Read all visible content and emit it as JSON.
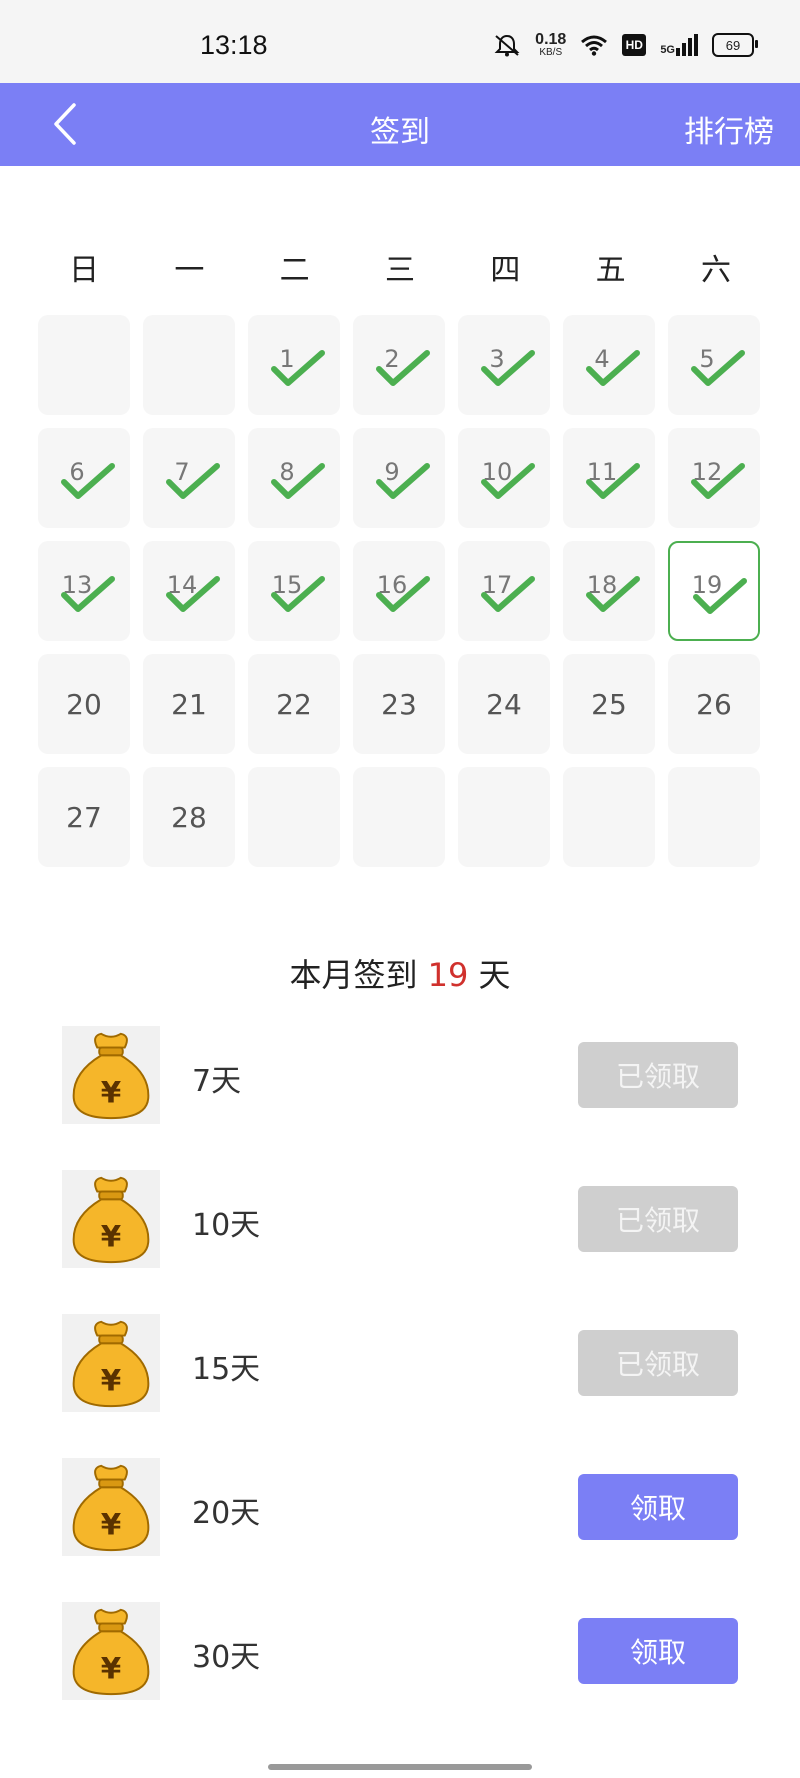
{
  "status_bar": {
    "time": "13:18",
    "speed_value": "0.18",
    "speed_unit": "KB/S",
    "hd": "HD",
    "network": "5G",
    "battery": "69"
  },
  "header": {
    "title": "签到",
    "right_action": "排行榜"
  },
  "calendar": {
    "weekdays": [
      "日",
      "一",
      "二",
      "三",
      "四",
      "五",
      "六"
    ],
    "today": 19,
    "cells": [
      "",
      "",
      "1",
      "2",
      "3",
      "4",
      "5",
      "6",
      "7",
      "8",
      "9",
      "10",
      "11",
      "12",
      "13",
      "14",
      "15",
      "16",
      "17",
      "18",
      "19",
      "20",
      "21",
      "22",
      "23",
      "24",
      "25",
      "26",
      "27",
      "28",
      "",
      "",
      "",
      "",
      ""
    ],
    "checked_up_to": 19
  },
  "summary": {
    "prefix": "本月签到",
    "days": "19",
    "suffix": "天"
  },
  "rewards": [
    {
      "label": "7天",
      "button": "已领取",
      "state": "claimed"
    },
    {
      "label": "10天",
      "button": "已领取",
      "state": "claimed"
    },
    {
      "label": "15天",
      "button": "已领取",
      "state": "claimed"
    },
    {
      "label": "20天",
      "button": "领取",
      "state": "available"
    },
    {
      "label": "30天",
      "button": "领取",
      "state": "available"
    }
  ],
  "colors": {
    "accent": "#7b7ff5",
    "check": "#4caf50",
    "highlight": "#d0312d",
    "claimed": "#cfcfcf"
  }
}
